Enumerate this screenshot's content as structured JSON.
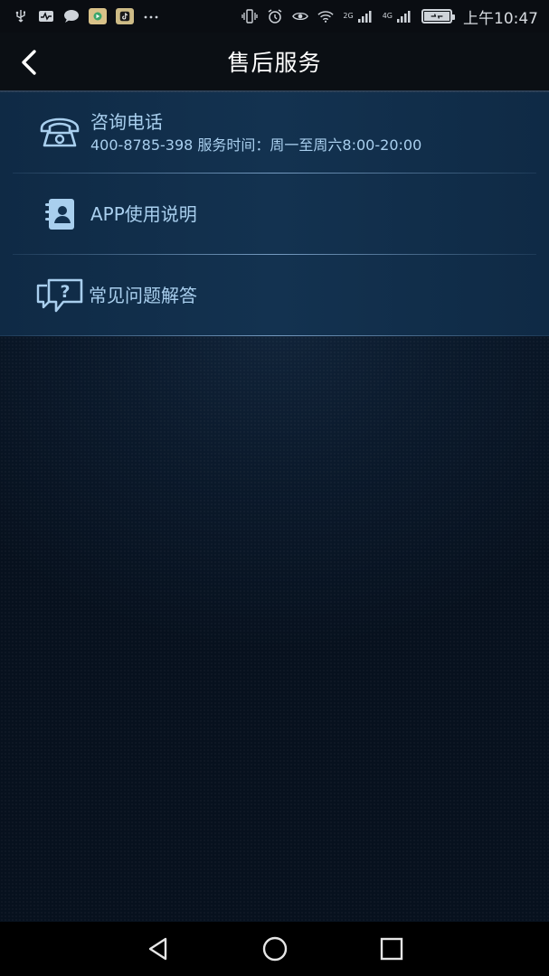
{
  "status_bar": {
    "time": "上午10:47",
    "network_2g": "2G",
    "network_4g": "4G",
    "left_icons": [
      "usb-icon",
      "activity-icon",
      "chat-icon",
      "video-app-icon",
      "tiktok-icon",
      "more-dots-icon"
    ],
    "right_icons": [
      "vibrate-icon",
      "alarm-icon",
      "eye-icon",
      "wifi-icon",
      "signal-icon",
      "signal-icon",
      "battery-icon"
    ]
  },
  "header": {
    "title": "售后服务",
    "back_icon": "chevron-left-icon"
  },
  "menu": {
    "items": [
      {
        "icon": "telephone-icon",
        "title": "咨询电话",
        "subtitle": "400-8785-398 服务时间：周一至周六8:00-20:00"
      },
      {
        "icon": "contact-book-icon",
        "title": "APP使用说明"
      },
      {
        "icon": "question-chat-icon",
        "title": "常见问题解答"
      }
    ]
  },
  "nav_bar": {
    "icons": [
      "back-triangle-icon",
      "home-circle-icon",
      "recents-square-icon"
    ]
  },
  "colors": {
    "accent_text": "#a9cfee",
    "item_background": "#133250",
    "header_background": "#0b0f14",
    "page_background": "#07111e"
  }
}
